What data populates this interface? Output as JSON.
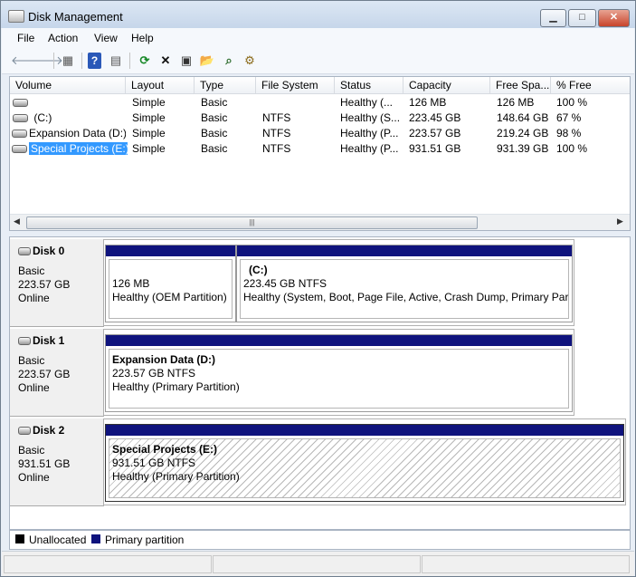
{
  "window": {
    "title": "Disk Management"
  },
  "window_controls": {
    "minimize": "▁",
    "maximize": "□",
    "close": "✕"
  },
  "menu": [
    "File",
    "Action",
    "View",
    "Help"
  ],
  "toolbar": {
    "icons": [
      "back-arrow-icon",
      "forward-arrow-icon",
      "show-hide-console-tree-icon",
      "help-icon",
      "properties-view-icon",
      "refresh-icon",
      "delete-icon",
      "properties-icon",
      "open-folder-icon",
      "find-icon",
      "disk-settings-icon"
    ],
    "glyphs": {
      "back": "🡐",
      "forward": "🡒",
      "console": "▦",
      "help": "?",
      "view": "▤",
      "refresh": "⟳",
      "delete": "✕",
      "properties": "▣",
      "open": "📂",
      "find": "⌕",
      "settings": "⚙"
    }
  },
  "volume_list": {
    "columns": [
      "Volume",
      "Layout",
      "Type",
      "File System",
      "Status",
      "Capacity",
      "Free Spa...",
      "% Free"
    ],
    "rows": [
      {
        "volume": "",
        "layout": "Simple",
        "type": "Basic",
        "fs": "",
        "status": "Healthy (...",
        "capacity": "126 MB",
        "free": "126 MB",
        "pct": "100 %"
      },
      {
        "volume": "(C:)",
        "layout": "Simple",
        "type": "Basic",
        "fs": "NTFS",
        "status": "Healthy (S...",
        "capacity": "223.45 GB",
        "free": "148.64 GB",
        "pct": "67 %"
      },
      {
        "volume": "Expansion Data (D:)",
        "layout": "Simple",
        "type": "Basic",
        "fs": "NTFS",
        "status": "Healthy (P...",
        "capacity": "223.57 GB",
        "free": "219.24 GB",
        "pct": "98 %"
      },
      {
        "volume": "Special Projects (E:)",
        "layout": "Simple",
        "type": "Basic",
        "fs": "NTFS",
        "status": "Healthy (P...",
        "capacity": "931.51 GB",
        "free": "931.39 GB",
        "pct": "100 %"
      }
    ],
    "scroll_left": "◀",
    "scroll_right": "▶",
    "scroll_grip": "|||"
  },
  "disks": [
    {
      "name": "Disk 0",
      "type": "Basic",
      "size": "223.57 GB",
      "state": "Online",
      "partitions": [
        {
          "label": "",
          "size": "126 MB",
          "status": "Healthy (OEM Partition)"
        },
        {
          "label": "(C:)",
          "size": "223.45 GB NTFS",
          "status": "Healthy (System, Boot, Page File, Active, Crash Dump, Primary Partition)"
        }
      ]
    },
    {
      "name": "Disk 1",
      "type": "Basic",
      "size": "223.57 GB",
      "state": "Online",
      "partitions": [
        {
          "label": "Expansion Data  (D:)",
          "size": "223.57 GB NTFS",
          "status": "Healthy (Primary Partition)"
        }
      ]
    },
    {
      "name": "Disk 2",
      "type": "Basic",
      "size": "931.51 GB",
      "state": "Online",
      "partitions": [
        {
          "label": "Special Projects  (E:)",
          "size": "931.51 GB NTFS",
          "status": "Healthy (Primary Partition)"
        }
      ]
    }
  ],
  "legend": {
    "unallocated": "Unallocated",
    "primary": "Primary partition",
    "unallocated_color": "#000000",
    "primary_color": "#0f137d"
  }
}
